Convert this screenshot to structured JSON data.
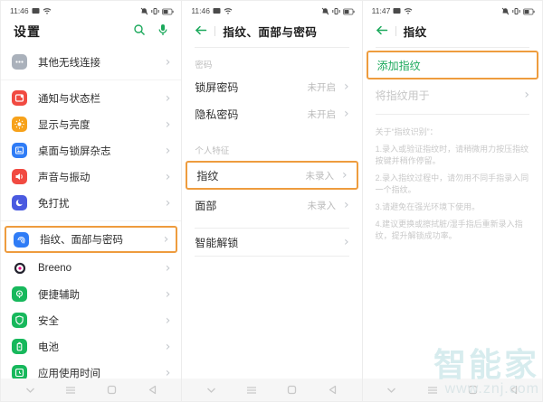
{
  "colors": {
    "accent_green": "#1CA95C",
    "highlight_orange": "#EE9C3E",
    "row_text": "#2d2d2d",
    "muted_text": "#bbbbbb",
    "navbar_bg": "#f6f6f6",
    "watermark_blue": "#d7ecee"
  },
  "panel1": {
    "time": "11:46",
    "title": "设置",
    "items": [
      {
        "label": "其他无线连接",
        "icon": "wireless-more-icon",
        "icon_bg": "#aab1bb"
      },
      {
        "label": "通知与状态栏",
        "icon": "notification-icon",
        "icon_bg": "#f14a41"
      },
      {
        "label": "显示与亮度",
        "icon": "sun-icon",
        "icon_bg": "#f7a21b"
      },
      {
        "label": "桌面与锁屏杂志",
        "icon": "photo-icon",
        "icon_bg": "#2f7cf6"
      },
      {
        "label": "声音与振动",
        "icon": "speaker-icon",
        "icon_bg": "#f14a41"
      },
      {
        "label": "免打扰",
        "icon": "moon-icon",
        "icon_bg": "#4a5ae0"
      },
      {
        "label": "指纹、面部与密码",
        "icon": "fingerprint-icon",
        "icon_bg": "#2f7cf6"
      },
      {
        "label": "Breeno",
        "icon": "breeno-icon",
        "icon_bg": "transparent"
      },
      {
        "label": "便捷辅助",
        "icon": "assist-icon",
        "icon_bg": "#17b85c"
      },
      {
        "label": "安全",
        "icon": "shield-icon",
        "icon_bg": "#17b85c"
      },
      {
        "label": "电池",
        "icon": "battery-icon",
        "icon_bg": "#17b85c"
      },
      {
        "label": "应用使用时间",
        "icon": "app-usage-icon",
        "icon_bg": "#17b85c"
      }
    ]
  },
  "panel2": {
    "time": "11:46",
    "title": "指纹、面部与密码",
    "section_password": "密码",
    "rows_password": [
      {
        "label": "锁屏密码",
        "value": "未开启"
      },
      {
        "label": "隐私密码",
        "value": "未开启"
      }
    ],
    "section_personal": "个人特征",
    "rows_personal": [
      {
        "label": "指纹",
        "value": "未录入"
      },
      {
        "label": "面部",
        "value": "未录入"
      }
    ],
    "smart_unlock": "智能解锁"
  },
  "panel3": {
    "time": "11:47",
    "title": "指纹",
    "add_fingerprint": "添加指纹",
    "use_fingerprint_for": "将指纹用于",
    "about_title": "关于“指纹识别”：",
    "about_lines": [
      "1.录入或验证指纹时，请稍微用力按压指纹按键并稍作停留。",
      "2.录入指纹过程中，请勿用不同手指录入同一个指纹。",
      "3.请避免在强光环境下使用。",
      "4.建议更换或擦拭脏/湿手指后重新录入指纹，提升解锁成功率。"
    ]
  },
  "watermark": {
    "title": "智能家",
    "url": "www.znj.com"
  }
}
